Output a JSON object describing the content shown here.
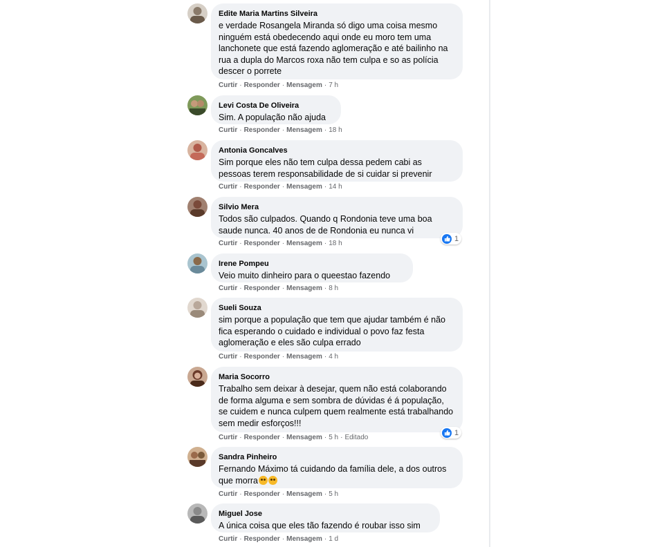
{
  "comments": [
    {
      "author": "Edite Maria Martins Silveira",
      "text": "e verdade Rosangela Miranda só digo uma coisa mesmo ninguém está obedecendo aqui onde eu moro tem uma lanchonete que está fazendo aglomeração e até bailinho na rua a dupla do Marcos roxa não tem culpa e so as polícia descer o porrete",
      "time": "7 h",
      "avatar_color": "#8a7a6a"
    },
    {
      "author": "Levi Costa De Oliveira",
      "text": "Sim. A população não ajuda",
      "time": "18 h",
      "avatar_color": "#4f6b3a"
    },
    {
      "author": "Antonia Goncalves",
      "text": "Sim porque eles não tem culpa dessa pedem cabi as pessoas terem responsabilidade de si cuidar si prevenir",
      "time": "14 h",
      "avatar_color": "#b05a4a"
    },
    {
      "author": "Silvio Mera",
      "text": "Todos são culpados. Quando q Rondonia teve uma boa saude nunca. 40 anos de de Rondonia eu nunca vi",
      "time": "18 h",
      "reaction_count": "1",
      "avatar_color": "#7a4a3a"
    },
    {
      "author": "Irene Pompeu",
      "text": "Veio muito dinheiro para o queestao fazendo",
      "time": "8 h",
      "avatar_color": "#6a8a9a"
    },
    {
      "author": "Sueli Souza",
      "text": "sim porque a população que tem que ajudar também é não fica esperando o cuidado e individual o povo faz festa aglomeração e eles são culpa errado",
      "time": "4 h",
      "avatar_color": "#b9a89a"
    },
    {
      "author": "Maria Socorro",
      "text": "Trabalho sem deixar à desejar, quem não está colaborando de forma alguma e sem sombra de dúvidas é á população, se cuidem e nunca culpem quem realmente está trabalhando sem medir esforços!!!",
      "time": "5 h",
      "edited": "Editado",
      "reaction_count": "1",
      "avatar_color": "#6a3a2a"
    },
    {
      "author": "Sandra Pinheiro",
      "text": "Fernando Máximo tá cuidando da família dele, a dos outros que morra",
      "time": "5 h",
      "avatar_color": "#9a6a4a"
    },
    {
      "author": "Miguel Jose",
      "text": "A única coisa que eles tão fazendo é roubar isso sim",
      "time": "1 d",
      "avatar_color": "#8a8a8a"
    }
  ],
  "actions": {
    "like": "Curtir",
    "reply": "Responder",
    "message": "Mensagem"
  },
  "colors": {
    "bubble": "#f0f2f5",
    "meta_text": "#65676b",
    "like_blue": "#1877f2"
  }
}
